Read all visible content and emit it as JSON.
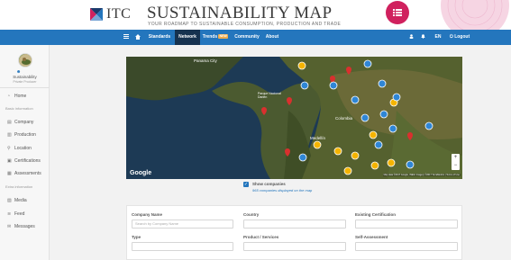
{
  "header": {
    "logo_text": "ITC",
    "site_title": "SUSTAINABILITY MAP",
    "tagline": "YOUR ROADMAP TO SUSTAINABLE CONSUMPTION, PRODUCTION AND TRADE",
    "menu_icon": "list-icon",
    "colors": {
      "brand_blue": "#2476bd",
      "nav_active": "#16324f",
      "badge_pink": "#d0215e",
      "marker_red": "#d9302e",
      "marker_blue": "#2f86d6",
      "marker_yellow": "#f4b400"
    }
  },
  "nav": {
    "items": [
      {
        "label": "",
        "icon": "menu-icon"
      },
      {
        "label": "",
        "icon": "home-icon"
      },
      {
        "label": "Standards"
      },
      {
        "label": "Network",
        "active": true
      },
      {
        "label": "Trends",
        "badge": "NEW"
      },
      {
        "label": "Community"
      },
      {
        "label": "About"
      }
    ],
    "right": {
      "user_icon": "user-icon",
      "notif_icon": "bell-icon",
      "lang": "EN",
      "logout": "Logout"
    }
  },
  "sidebar": {
    "user_name": "Sustainability",
    "user_role": "Private Producer",
    "items": [
      {
        "label": "Home",
        "icon": "gauge-icon"
      },
      {
        "section": "Basic information"
      },
      {
        "label": "Company",
        "icon": "building-icon"
      },
      {
        "label": "Production",
        "icon": "factory-icon"
      },
      {
        "label": "Location",
        "icon": "map-pin-icon"
      },
      {
        "label": "Certifications",
        "icon": "certificate-icon"
      },
      {
        "label": "Assessments",
        "icon": "clipboard-icon"
      },
      {
        "section": "Extra information"
      },
      {
        "label": "Media",
        "icon": "image-icon"
      },
      {
        "label": "Feed",
        "icon": "feed-icon"
      },
      {
        "label": "Messages",
        "icon": "chat-icon"
      }
    ]
  },
  "map": {
    "provider": "Google",
    "attribution": "Map data ©2017 Google, INEGI Imagery ©2017 TerraMetrics | Terms of Use",
    "labels": [
      "Panama City",
      "Parque Nacional Darién",
      "Medellín",
      "Colombia"
    ],
    "zoom_in": "+",
    "zoom_out": "−"
  },
  "filters": {
    "show_companies_label": "Show companies",
    "displayed_count": "965 companies displayed on the map",
    "company_name_label": "Company Name",
    "company_name_placeholder": "Search by Company Name",
    "country_label": "Country",
    "existing_cert_label": "Existing Certification",
    "type_label": "Type",
    "product_label": "Product / Services",
    "self_assessment_label": "Self-Assessment"
  }
}
